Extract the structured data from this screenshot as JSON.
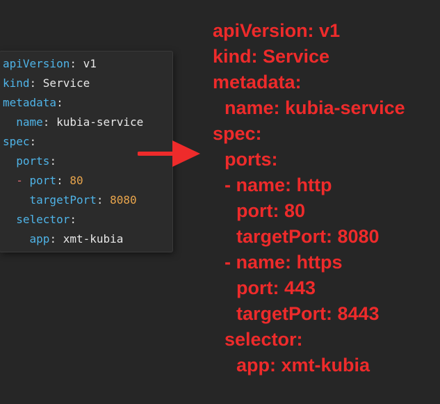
{
  "editor": {
    "lines": [
      {
        "key": "apiVersion",
        "sep": ": ",
        "value": "v1",
        "vtype": "str"
      },
      {
        "key": "kind",
        "sep": ": ",
        "value": "Service",
        "vtype": "str"
      },
      {
        "key": "metadata",
        "sep": ":",
        "value": "",
        "vtype": "str"
      },
      {
        "indent": "  ",
        "key": "name",
        "sep": ": ",
        "value": "kubia-service",
        "vtype": "str"
      },
      {
        "key": "spec",
        "sep": ":",
        "value": "",
        "vtype": "str"
      },
      {
        "indent": "  ",
        "key": "ports",
        "sep": ":",
        "value": "",
        "vtype": "str"
      },
      {
        "indent": "  ",
        "dash": "- ",
        "key": "port",
        "sep": ": ",
        "value": "80",
        "vtype": "num"
      },
      {
        "indent": "    ",
        "key": "targetPort",
        "sep": ": ",
        "value": "8080",
        "vtype": "num"
      },
      {
        "indent": "  ",
        "key": "selector",
        "sep": ":",
        "value": "",
        "vtype": "str"
      },
      {
        "indent": "    ",
        "key": "app",
        "sep": ": ",
        "value": "xmt-kubia",
        "vtype": "str"
      }
    ]
  },
  "annotation": {
    "lines": [
      {
        "text": "apiVersion: v1",
        "level": 0
      },
      {
        "text": "kind: Service",
        "level": 0
      },
      {
        "text": "metadata:",
        "level": 0
      },
      {
        "text": "name: kubia-service",
        "level": 1
      },
      {
        "text": "spec:",
        "level": 0
      },
      {
        "text": "ports:",
        "level": 1
      },
      {
        "text": "- name: http",
        "level": 1
      },
      {
        "text": "port: 80",
        "level": 2
      },
      {
        "text": "targetPort: 8080",
        "level": 2
      },
      {
        "text": "- name: https",
        "level": 1
      },
      {
        "text": "port: 443",
        "level": 2
      },
      {
        "text": "targetPort: 8443",
        "level": 2
      },
      {
        "text": "selector:",
        "level": 1
      },
      {
        "text": "app: xmt-kubia",
        "level": 2
      }
    ]
  },
  "colors": {
    "background": "#262626",
    "editor_background": "#2b2b2b",
    "yaml_key": "#4fb4e8",
    "yaml_number": "#e9a54c",
    "yaml_dash": "#e06c75",
    "annotation": "#ee2b2b"
  },
  "icons": {
    "arrow": "right-arrow-icon"
  }
}
